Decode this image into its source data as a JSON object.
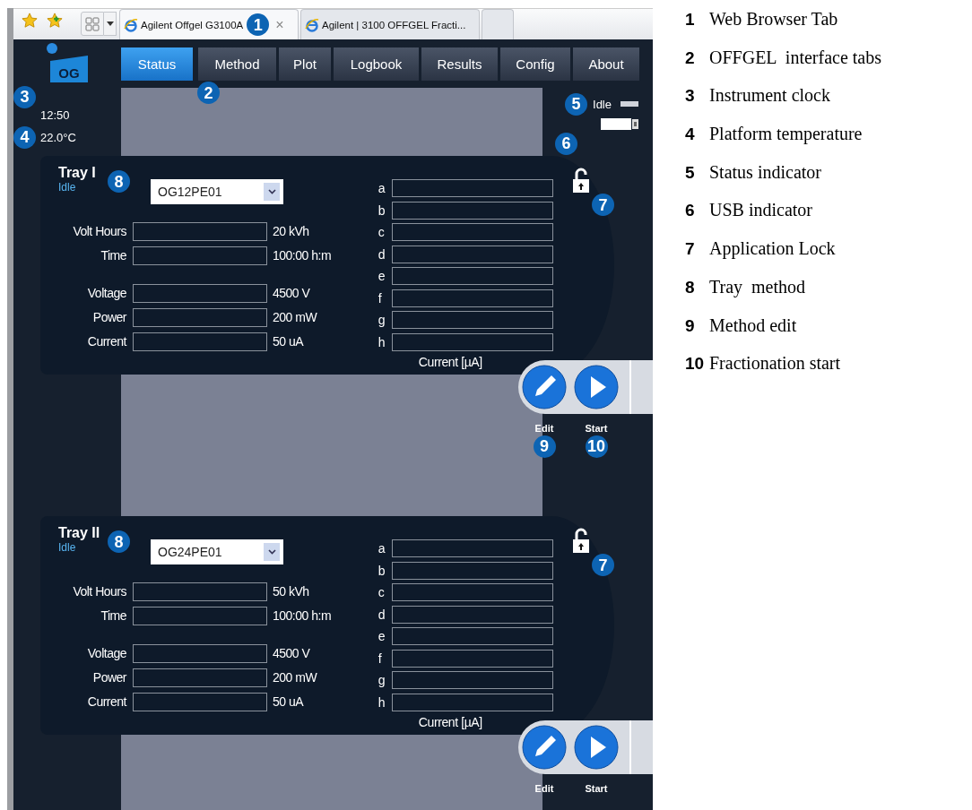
{
  "browser": {
    "tabs": [
      {
        "title": "Agilent Offgel G3100A",
        "selected": true,
        "close": "×",
        "callout": "1"
      },
      {
        "title": "Agilent | 3100 OFFGEL Fracti...",
        "selected": false
      }
    ]
  },
  "app": {
    "logo_text": "OG",
    "nav_tabs": [
      {
        "label": "Status",
        "selected": true
      },
      {
        "label": "Method",
        "selected": false,
        "callout": "2"
      },
      {
        "label": "Plot",
        "selected": false
      },
      {
        "label": "Logbook",
        "selected": false
      },
      {
        "label": "Results",
        "selected": false
      },
      {
        "label": "Config",
        "selected": false
      },
      {
        "label": "About",
        "selected": false
      }
    ],
    "clock": "12:50",
    "clock_callout": "3",
    "temperature": "22.0°C",
    "temperature_callout": "4",
    "status": "Idle",
    "status_callout": "5",
    "usb_callout": "6"
  },
  "trays": [
    {
      "title": "Tray I",
      "status": "Idle",
      "method": "OG12PE01",
      "method_callout": "8",
      "locked": false,
      "lock_callout": "7",
      "parameters": [
        {
          "label": "Volt Hours",
          "unit": "20 kVh"
        },
        {
          "label": "Time",
          "unit": "100:00 h:m"
        },
        {
          "label": "Voltage",
          "unit": "4500 V"
        },
        {
          "label": "Power",
          "unit": "200 mW"
        },
        {
          "label": "Current",
          "unit": "50 uA"
        }
      ],
      "channels": [
        "a",
        "b",
        "c",
        "d",
        "e",
        "f",
        "g",
        "h"
      ],
      "channels_caption": "Current [µA]",
      "actions": [
        {
          "kind": "edit",
          "label": "Edit",
          "callout": "9"
        },
        {
          "kind": "start",
          "label": "Start",
          "callout": "10"
        }
      ]
    },
    {
      "title": "Tray II",
      "status": "Idle",
      "method": "OG24PE01",
      "method_callout": "8",
      "locked": false,
      "lock_callout": "7",
      "parameters": [
        {
          "label": "Volt Hours",
          "unit": "50 kVh"
        },
        {
          "label": "Time",
          "unit": "100:00 h:m"
        },
        {
          "label": "Voltage",
          "unit": "4500 V"
        },
        {
          "label": "Power",
          "unit": "200 mW"
        },
        {
          "label": "Current",
          "unit": "50 uA"
        }
      ],
      "channels": [
        "a",
        "b",
        "c",
        "d",
        "e",
        "f",
        "g",
        "h"
      ],
      "channels_caption": "Current [µA]",
      "actions": [
        {
          "kind": "edit",
          "label": "Edit"
        },
        {
          "kind": "start",
          "label": "Start"
        }
      ]
    }
  ],
  "legend": [
    {
      "number": "1",
      "text": "Web Browser Tab"
    },
    {
      "number": "2",
      "text": "OFFGEL  interface tabs"
    },
    {
      "number": "3",
      "text": "Instrument clock"
    },
    {
      "number": "4",
      "text": "Platform temperature"
    },
    {
      "number": "5",
      "text": "Status indicator"
    },
    {
      "number": "6",
      "text": "USB indicator"
    },
    {
      "number": "7",
      "text": "Application Lock"
    },
    {
      "number": "8",
      "text": "Tray  method"
    },
    {
      "number": "9",
      "text": "Method edit"
    },
    {
      "number": "10",
      "text": "Fractionation start"
    }
  ]
}
